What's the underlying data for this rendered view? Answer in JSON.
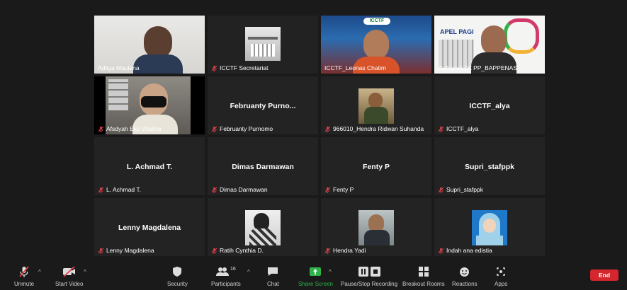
{
  "participants": [
    {
      "name": "Aditya Maulana",
      "muted": false,
      "video": true
    },
    {
      "name": "ICCTF Secretariat",
      "muted": true,
      "video": true
    },
    {
      "name": "ICCTF_Leonas Chatim",
      "muted": false,
      "video": true,
      "badge": "ICCTF"
    },
    {
      "name": "Zulfriandi Dit PP_BAPPENAS",
      "muted": false,
      "video": true,
      "banner": "APEL PAGI"
    },
    {
      "name": "Afsdyah Eky Vitalina",
      "muted": true,
      "video": true
    },
    {
      "name": "Februanty Purnomo",
      "center": "Februanty  Purno...",
      "muted": true,
      "video": false
    },
    {
      "name": "966010_Hendra Ridwan Suhanda",
      "muted": true,
      "video": false,
      "thumb": true
    },
    {
      "name": "ICCTF_alya",
      "center": "ICCTF_alya",
      "muted": true,
      "video": false
    },
    {
      "name": "L. Achmad T.",
      "center": "L. Achmad T.",
      "muted": true,
      "video": false
    },
    {
      "name": "Dimas Darmawan",
      "center": "Dimas Darmawan",
      "muted": true,
      "video": false
    },
    {
      "name": "Fenty P",
      "center": "Fenty P",
      "muted": true,
      "video": false
    },
    {
      "name": "Supri_stafppk",
      "center": "Supri_stafppk",
      "muted": true,
      "video": false
    },
    {
      "name": "Lenny Magdalena",
      "center": "Lenny Magdalena",
      "muted": true,
      "video": false
    },
    {
      "name": "Ratih Cynthia D.",
      "muted": true,
      "video": false,
      "thumb": true
    },
    {
      "name": "Hendra Yadi",
      "muted": true,
      "video": false,
      "thumb": true
    },
    {
      "name": "Indah ana edistia",
      "muted": true,
      "video": false,
      "thumb": true
    }
  ],
  "toolbar": {
    "unmute": "Unmute",
    "start_video": "Start Video",
    "security": "Security",
    "participants": "Participants",
    "participants_count": "16",
    "chat": "Chat",
    "share_screen": "Share Screen",
    "recording": "Pause/Stop Recording",
    "breakout": "Breakout Rooms",
    "reactions": "Reactions",
    "apps": "Apps",
    "end": "End"
  },
  "colors": {
    "active_border": "#c9d84b",
    "end": "#d6262d",
    "share": "#2fb34a",
    "muted": "#e0424b"
  }
}
